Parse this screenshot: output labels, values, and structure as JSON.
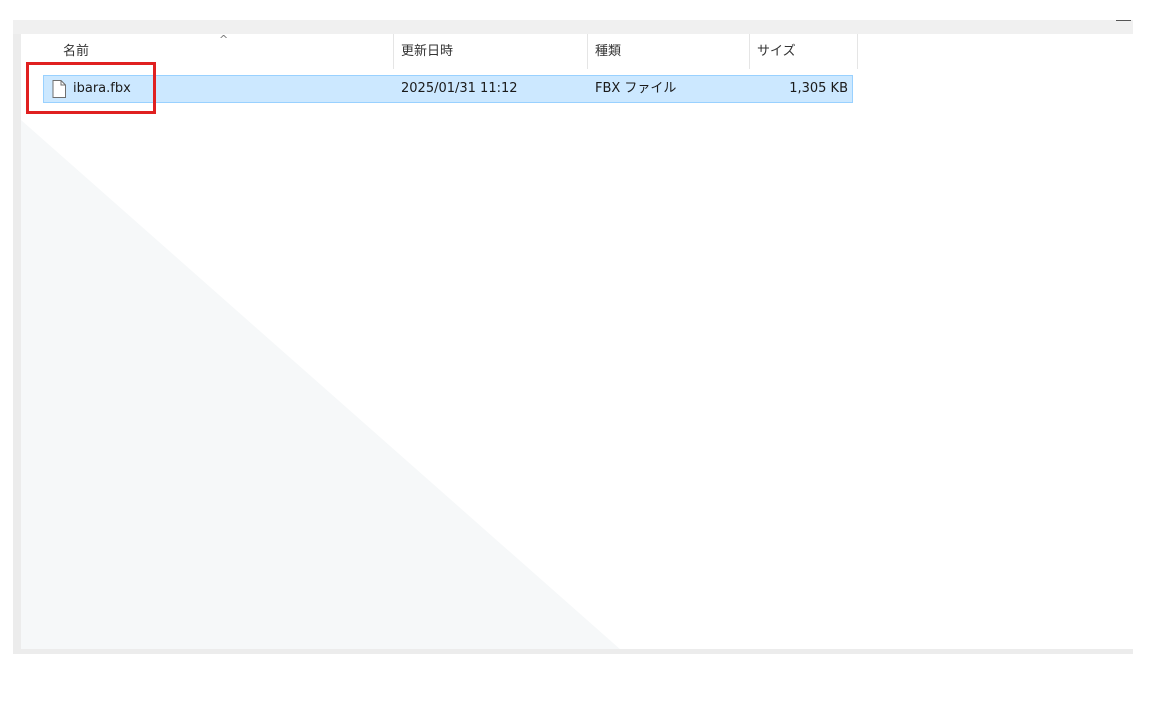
{
  "columns": {
    "name": "名前",
    "modified": "更新日時",
    "type": "種類",
    "size": "サイズ"
  },
  "files": [
    {
      "name": "ibara.fbx",
      "modified": "2025/01/31 11:12",
      "type": "FBX ファイル",
      "size": "1,305 KB",
      "icon": "file-icon"
    }
  ],
  "colors": {
    "selection": "#cce8ff",
    "selection_border": "#99d1ff",
    "highlight": "#e02020"
  }
}
